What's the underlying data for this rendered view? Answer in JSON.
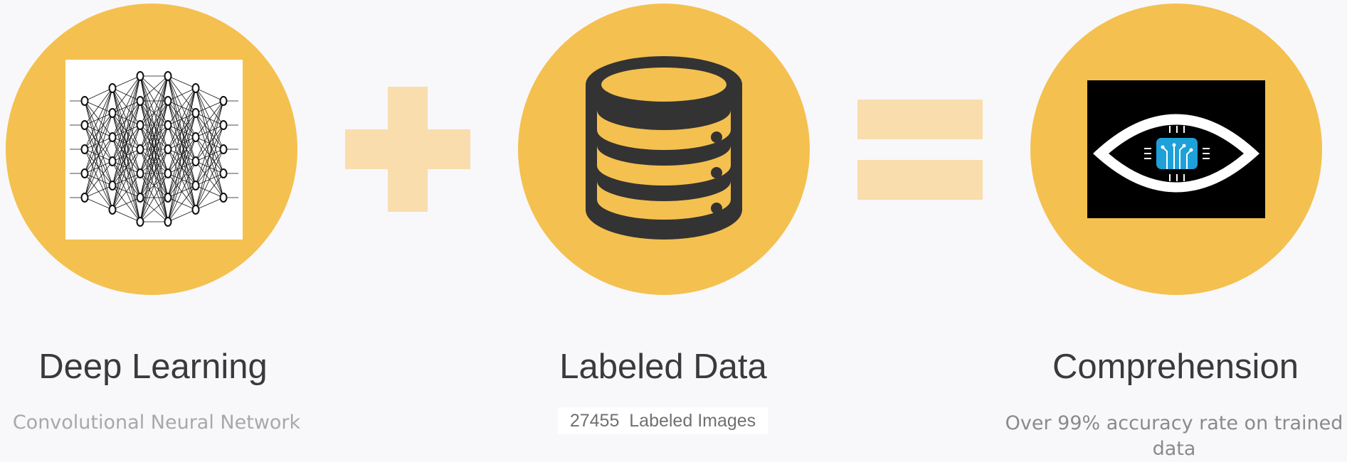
{
  "columns": [
    {
      "title": "Deep Learning",
      "subtitle": "Convolutional Neural Network",
      "icon": "neural-network-icon"
    },
    {
      "title": "Labeled Data",
      "count": "27455",
      "subtitle": "Labeled Images",
      "icon": "database-icon"
    },
    {
      "title": "Comprehension",
      "subtitle": "Over 99% accuracy rate on trained data",
      "icon": "ai-eye-icon"
    }
  ],
  "operators": [
    "plus-icon",
    "equals-icon"
  ],
  "colors": {
    "background": "#f8f8fa",
    "circle": "#f4c04f",
    "operator": "#f9ddad",
    "title": "#3a3a3a",
    "subtitle": "#a8a8a8",
    "database": "#333333",
    "chip": "#1ea0d8"
  }
}
